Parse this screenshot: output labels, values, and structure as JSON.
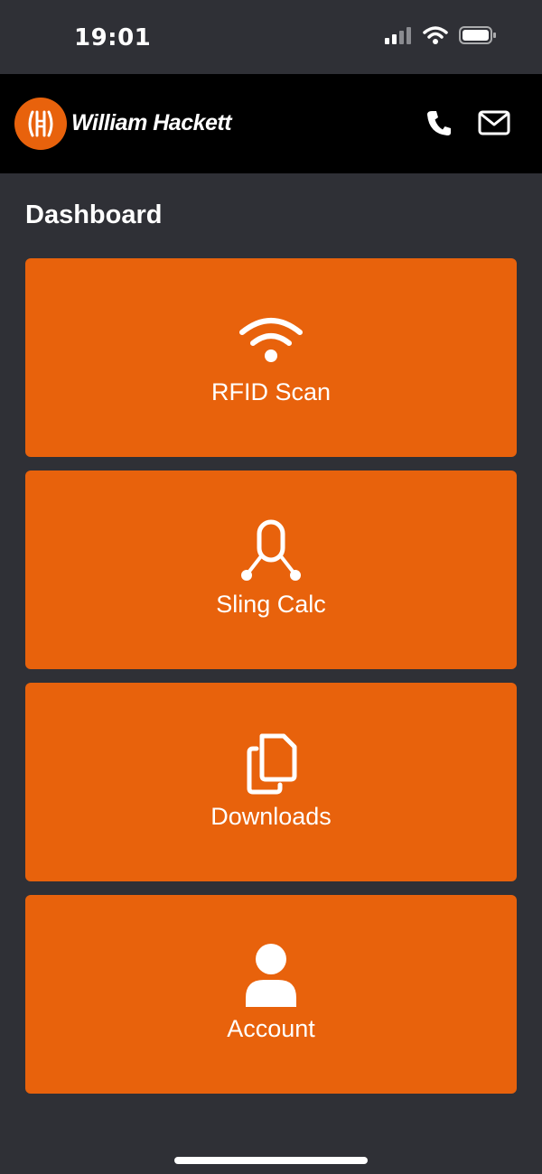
{
  "status_bar": {
    "time": "19:01",
    "icons": [
      "signal-icon",
      "wifi-icon",
      "battery-icon"
    ]
  },
  "header": {
    "brand": "William Hackett",
    "actions": [
      {
        "name": "phone-button",
        "icon": "phone-icon"
      },
      {
        "name": "email-button",
        "icon": "mail-icon"
      }
    ]
  },
  "page": {
    "title": "Dashboard"
  },
  "tiles": [
    {
      "label": "RFID Scan",
      "icon": "wifi-icon"
    },
    {
      "label": "Sling Calc",
      "icon": "sling-icon"
    },
    {
      "label": "Downloads",
      "icon": "documents-icon"
    },
    {
      "label": "Account",
      "icon": "user-icon"
    }
  ],
  "colors": {
    "accent": "#e8620c",
    "background": "#2f3036",
    "header": "#000000",
    "text": "#ffffff"
  }
}
